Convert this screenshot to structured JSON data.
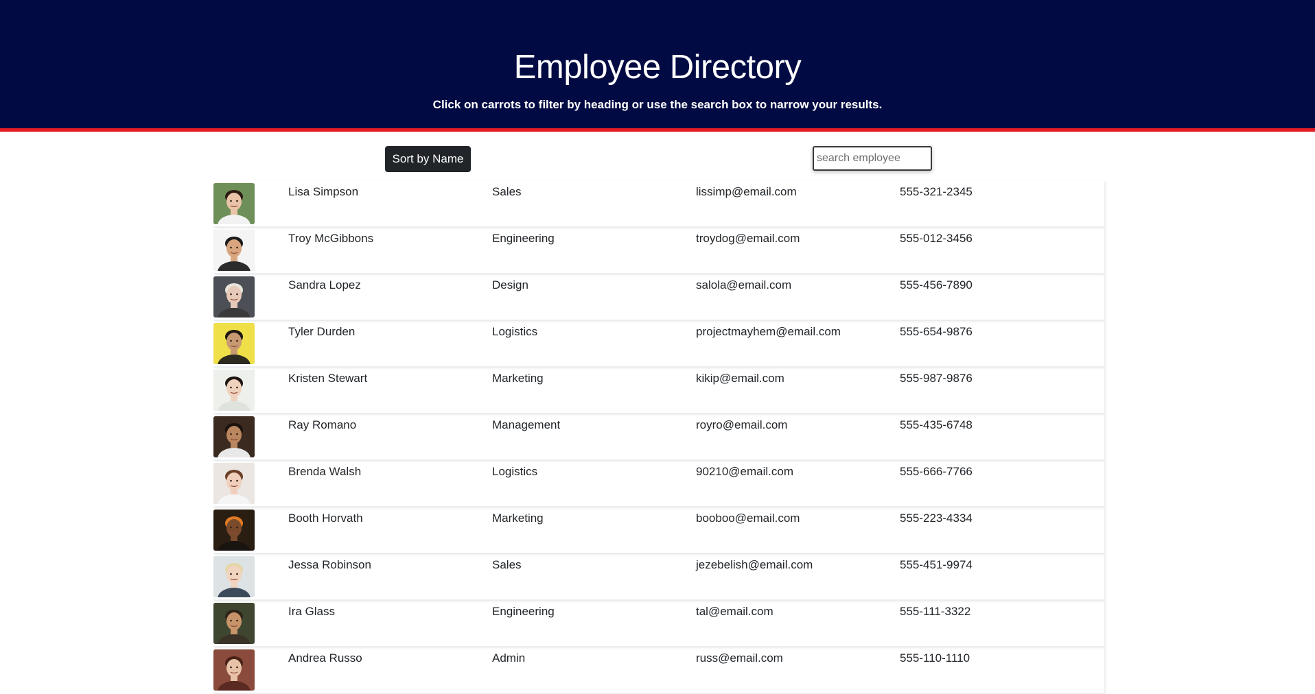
{
  "header": {
    "title": "Employee Directory",
    "subtitle": "Click on carrots to filter by heading or use the search box to narrow your results."
  },
  "toolbar": {
    "sort_label": "Sort by Name",
    "search_placeholder": "search employee",
    "search_value": ""
  },
  "colors": {
    "header_bg": "#010a43",
    "accent_red": "#e51b24",
    "button_bg": "#212529"
  },
  "employees": [
    {
      "name": "Lisa Simpson",
      "department": "Sales",
      "email": "lissimp@email.com",
      "phone": "555-321-2345",
      "avatar": {
        "bg": "#6f8f58",
        "skin": "#e9c4a8",
        "hair": "#2b1a12",
        "shirt": "#f2f2f2"
      }
    },
    {
      "name": "Troy McGibbons",
      "department": "Engineering",
      "email": "troydog@email.com",
      "phone": "555-012-3456",
      "avatar": {
        "bg": "#f4f4f4",
        "skin": "#d9a57e",
        "hair": "#1a1a1a",
        "shirt": "#2b2b2b"
      }
    },
    {
      "name": "Sandra Lopez",
      "department": "Design",
      "email": "salola@email.com",
      "phone": "555-456-7890",
      "avatar": {
        "bg": "#4c5056",
        "skin": "#e6c9b8",
        "hair": "#e8e4dc",
        "shirt": "#3a3a3a"
      }
    },
    {
      "name": "Tyler Durden",
      "department": "Logistics",
      "email": "projectmayhem@email.com",
      "phone": "555-654-9876",
      "avatar": {
        "bg": "#efe04a",
        "skin": "#c89a72",
        "hair": "#1e1510",
        "shirt": "#2d2a20"
      }
    },
    {
      "name": "Kristen Stewart",
      "department": "Marketing",
      "email": "kikip@email.com",
      "phone": "555-987-9876",
      "avatar": {
        "bg": "#eef0ec",
        "skin": "#efd2bd",
        "hair": "#1c1410",
        "shirt": "#dfe3dd"
      }
    },
    {
      "name": "Ray Romano",
      "department": "Management",
      "email": "royro@email.com",
      "phone": "555-435-6748",
      "avatar": {
        "bg": "#3b2a20",
        "skin": "#b98660",
        "hair": "#1b120c",
        "shirt": "#e8e8e8"
      }
    },
    {
      "name": "Brenda Walsh",
      "department": "Logistics",
      "email": "90210@email.com",
      "phone": "555-666-7766",
      "avatar": {
        "bg": "#ece6e2",
        "skin": "#f0cfbd",
        "hair": "#6b3e26",
        "shirt": "#f5f5f5"
      }
    },
    {
      "name": "Booth Horvath",
      "department": "Marketing",
      "email": "booboo@email.com",
      "phone": "555-223-4334",
      "avatar": {
        "bg": "#2a1d12",
        "skin": "#7a4a2c",
        "hair": "#e07a24",
        "shirt": "#1a1410"
      }
    },
    {
      "name": "Jessa Robinson",
      "department": "Sales",
      "email": "jezebelish@email.com",
      "phone": "555-451-9974",
      "avatar": {
        "bg": "#dde3e4",
        "skin": "#f0d4c0",
        "hair": "#e6d6a8",
        "shirt": "#3d4a5c"
      }
    },
    {
      "name": "Ira Glass",
      "department": "Engineering",
      "email": "tal@email.com",
      "phone": "555-111-3322",
      "avatar": {
        "bg": "#3f4630",
        "skin": "#c7946a",
        "hair": "#2e2418",
        "shirt": "#3a3226"
      }
    },
    {
      "name": "Andrea Russo",
      "department": "Admin",
      "email": "russ@email.com",
      "phone": "555-110-1110",
      "avatar": {
        "bg": "#8a4a3c",
        "skin": "#e7c2a6",
        "hair": "#4a2218",
        "shirt": "#5a2a22"
      }
    }
  ]
}
